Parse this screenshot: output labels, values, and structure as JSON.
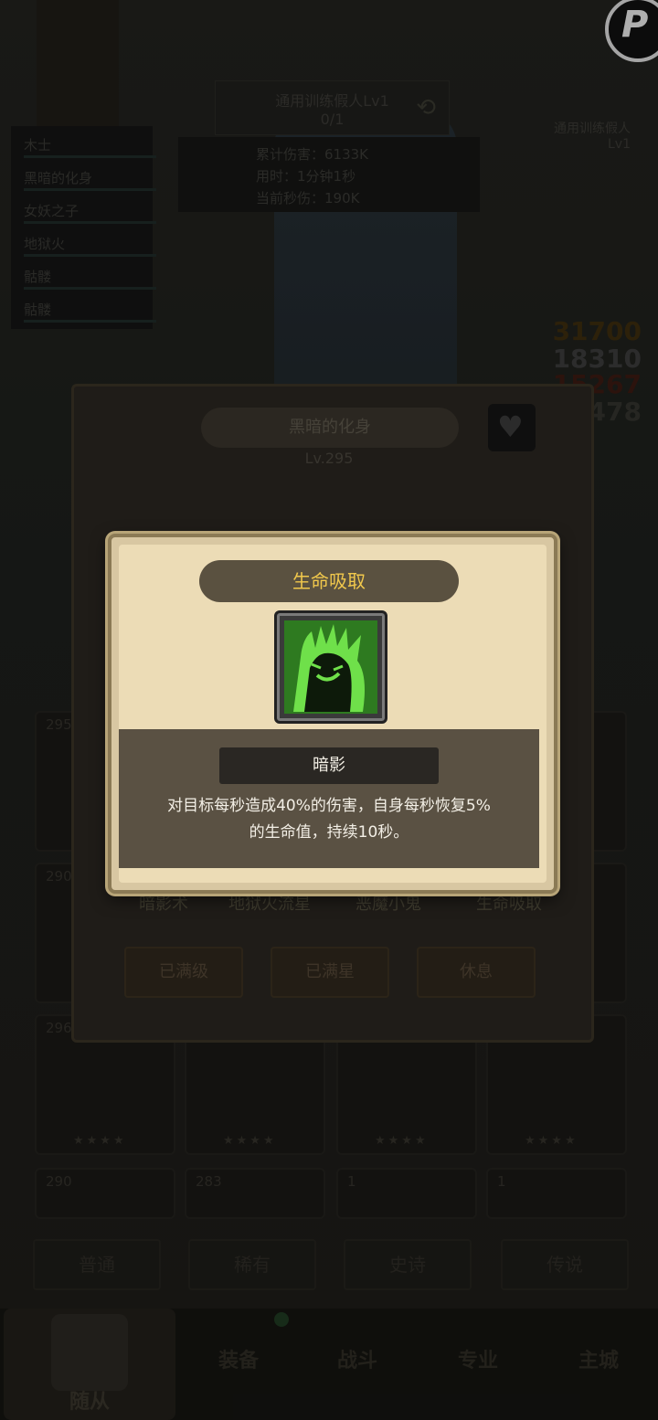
{
  "corner_button": {
    "label": "P"
  },
  "target_list": [
    "木士",
    "黑暗的化身",
    "女妖之子",
    "地狱火",
    "骷髅",
    "骷髅"
  ],
  "dummy": {
    "title": "通用训练假人Lv1",
    "progress": "0/1",
    "total_damage": "累计伤害：6133K",
    "time_used": "用时：1分钟1秒",
    "current_dps": "当前秒伤：190K"
  },
  "right_label": {
    "line1": "通用训练假人",
    "line2": "Lv1"
  },
  "damage_numbers": [
    "31700",
    "18310",
    "15267",
    "478"
  ],
  "hero": {
    "name": "黑暗的化身",
    "level": "Lv.295"
  },
  "hero_skills": [
    "暗影术",
    "地狱火流星",
    "恶魔小鬼",
    "生命吸取"
  ],
  "hero_buttons": [
    "已满级",
    "已满星",
    "休息"
  ],
  "cards_row1": [
    "295",
    "290"
  ],
  "cards_row2": [
    "296",
    "",
    "",
    ""
  ],
  "cards_row3": [
    "290",
    "283",
    "1",
    "1"
  ],
  "filters": [
    "普通",
    "稀有",
    "史诗",
    "传说"
  ],
  "nav": [
    "随从",
    "装备",
    "战斗",
    "专业",
    "主城"
  ],
  "popup": {
    "title": "生命吸取",
    "type": "暗影",
    "description_line1": "对目标每秒造成40%的伤害，自身每秒恢复5%",
    "description_line2": "的生命值，持续10秒。"
  },
  "colors": {
    "popup_title": "#f1c84c",
    "popup_bg": "#ecdcb6",
    "desc_bg": "#5a5143",
    "skill_green": "#3fae2e"
  }
}
